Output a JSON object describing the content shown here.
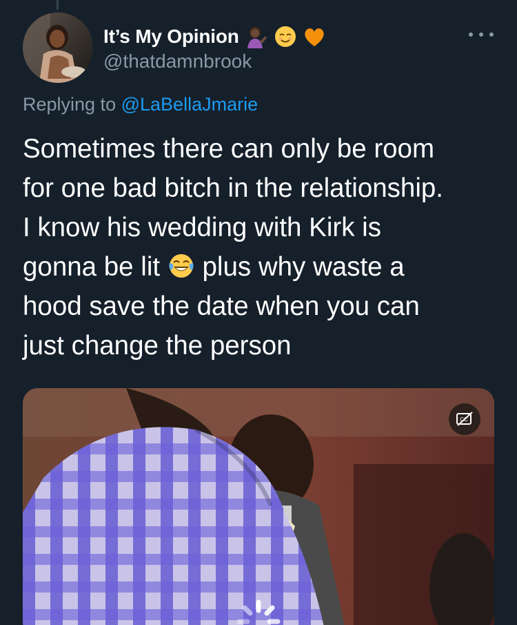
{
  "tweet": {
    "author": {
      "display_name": "It’s My Opinion",
      "handle": "@thatdamnbrook",
      "name_emojis": [
        "woman-tipping-hand-emoji",
        "relieved-face-emoji",
        "orange-heart-emoji"
      ]
    },
    "replying_to": {
      "prefix": "Replying to",
      "mention": "@LaBellaJmarie"
    },
    "text_lines": [
      "Sometimes there can only be room",
      "for one bad bitch in the relationship.",
      "I know his wedding with Kirk is",
      "gonna be lit",
      " plus why waste a",
      "hood save the date when you can",
      "just change the person"
    ],
    "inline_emoji": "face-with-tears-of-joy-emoji",
    "media": {
      "type": "video",
      "cc_icon": "closed-captions-off-icon",
      "loading_icon": "loading-spinner-icon"
    }
  },
  "colors": {
    "background": "#15202b",
    "text": "#ffffff",
    "secondary": "#8899a6",
    "accent": "#1d9bf0"
  }
}
